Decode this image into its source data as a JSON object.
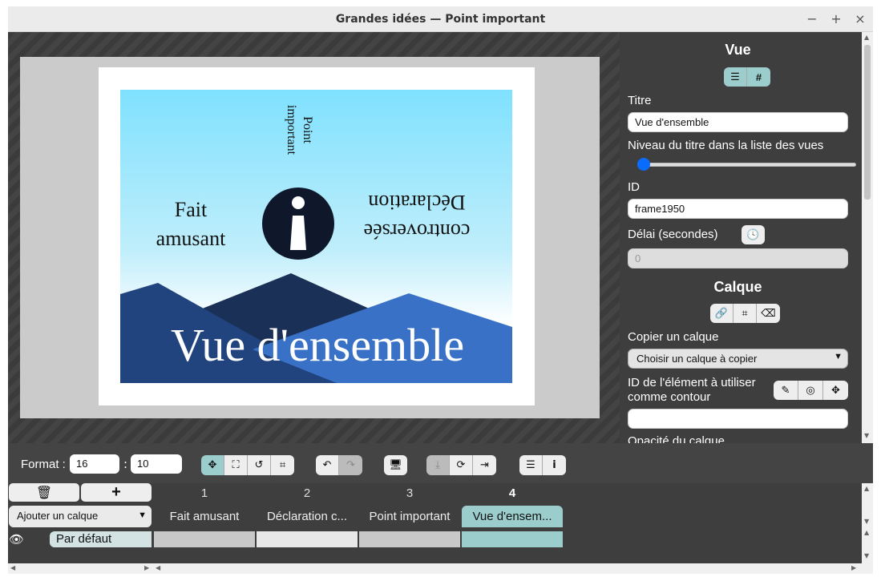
{
  "window": {
    "title": "Grandes idées — Point important",
    "minimize": "−",
    "maximize": "+",
    "close": "×"
  },
  "slide": {
    "title": "Vue d'ensemble",
    "left_text_1": "Fait",
    "left_text_2": "amusant",
    "right_text_1": "controversée",
    "right_text_2": "Déclaration",
    "top_text_1": "Point",
    "top_text_2": "important"
  },
  "panel": {
    "view_heading": "Vue",
    "title_label": "Titre",
    "title_value": "Vue d'ensemble",
    "level_label": "Niveau du titre dans la liste des vues",
    "level_value": 0,
    "id_label": "ID",
    "id_value": "frame1950",
    "delay_label": "Délai (secondes)",
    "delay_value": "0",
    "layer_heading": "Calque",
    "copy_label": "Copier un calque",
    "copy_select": "Choisir un calque à copier",
    "outline_label_1": "ID de l'élément à utiliser",
    "outline_label_2": "comme contour",
    "outline_value": "",
    "opacity_label": "Opacité du calque"
  },
  "toolbar": {
    "format_label": "Format :",
    "format_w": "16",
    "format_sep": ":",
    "format_h": "10"
  },
  "timeline": {
    "add_layer": "Ajouter un calque",
    "frame_numbers": [
      "1",
      "2",
      "3",
      "4"
    ],
    "frame_titles": [
      "Fait amusant",
      "Déclaration c...",
      "Point important",
      "Vue d'ensem..."
    ],
    "layer_name": "Par défaut",
    "delete_btn": "🗑",
    "add_btn": "+"
  },
  "colors": {
    "accent": "#9ccdcd",
    "panel_bg": "#3e3e3e",
    "slide_sky_top": "#7fe1fe",
    "mountain_dark": "#1b3057",
    "mountain_mid": "#21447f",
    "mountain_light": "#3971c7"
  }
}
